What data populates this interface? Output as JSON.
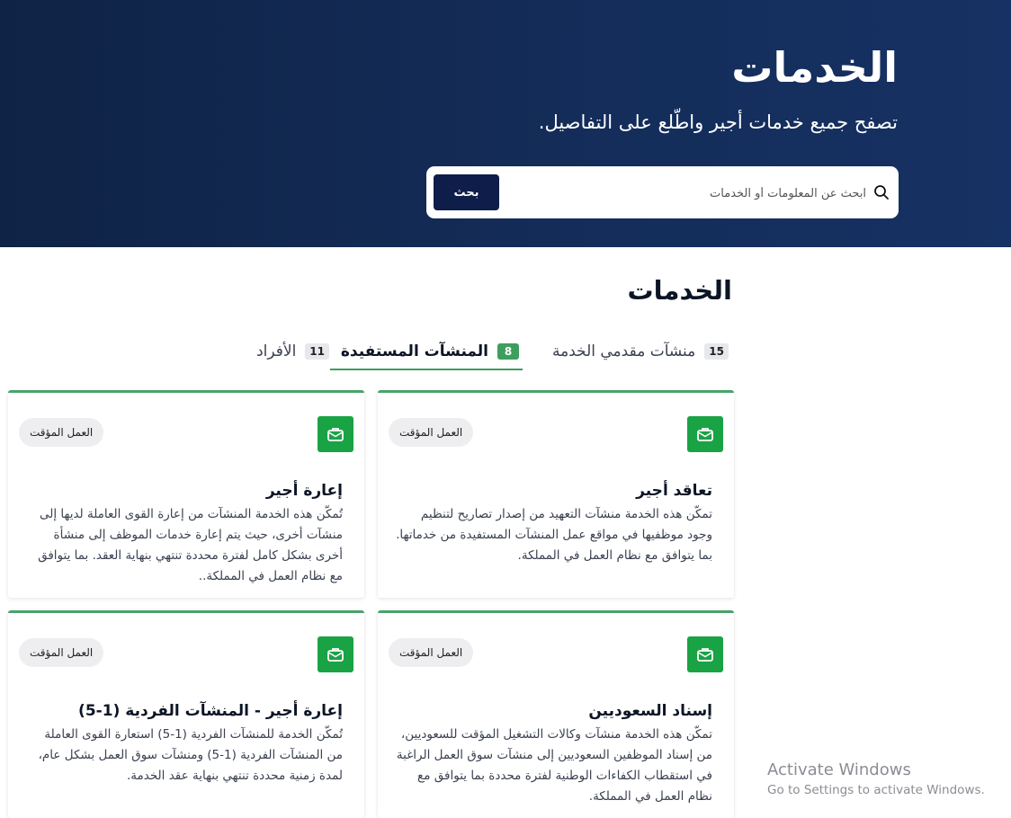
{
  "hero": {
    "title": "الخدمات",
    "subtitle": "تصفح جميع خدمات أجير واطّلع على التفاصيل.",
    "search_placeholder": "ابحث عن المعلومات أو الخدمات",
    "search_button": "بحث"
  },
  "section": {
    "title": "الخدمات"
  },
  "tabs": [
    {
      "label": "منشآت مقدمي الخدمة",
      "count": "15",
      "active": false
    },
    {
      "label": "المنشآت المستفيدة",
      "count": "8",
      "active": true
    },
    {
      "label": "الأفراد",
      "count": "11",
      "active": false
    }
  ],
  "cards": [
    {
      "title": "تعاقد أجير",
      "tag": "العمل المؤقت",
      "description": "تمكّن هذه الخدمة منشآت التعهيد من إصدار تصاريح لتنظيم وجود موظفيها في مواقع عمل المنشآت المستفيدة من خدماتها. بما يتوافق مع نظام العمل في المملكة."
    },
    {
      "title": "إعارة أجير",
      "tag": "العمل المؤقت",
      "description": "تُمكّن هذه الخدمة المنشآت من إعارة القوى العاملة لديها إلى منشآت أخرى، حيث يتم إعارة خدمات الموظف إلى منشأة أخرى بشكل كامل لفترة محددة تنتهي بنهاية العقد. بما يتوافق مع نظام العمل في المملكة.."
    },
    {
      "title": "إسناد السعوديين",
      "tag": "العمل المؤقت",
      "description": "تمكّن هذه الخدمة منشآت وكالات التشغيل المؤقت للسعوديين، من إسناد الموظفين السعوديين إلى منشآت سوق العمل الراغبة في استقطاب الكفاءات الوطنية لفترة محددة بما يتوافق مع نظام العمل في المملكة."
    },
    {
      "title": "إعارة أجير - المنشآت الفردية (1-5)",
      "tag": "العمل المؤقت",
      "description": "تُمكّن الخدمة للمنشآت الفردية (1-5) استعارة القوى العاملة من المنشآت الفردية (1-5) ومنشآت سوق العمل بشكل عام، لمدة زمنية محددة تنتهي بنهاية عقد الخدمة."
    }
  ],
  "watermark": {
    "line1": "Activate Windows",
    "line2": "Go to Settings to activate Windows."
  },
  "colors": {
    "hero_bg": "#142d5a",
    "button_bg": "#0f1d4a",
    "accent_green": "#3e9e5e",
    "icon_green": "#1aa345"
  }
}
